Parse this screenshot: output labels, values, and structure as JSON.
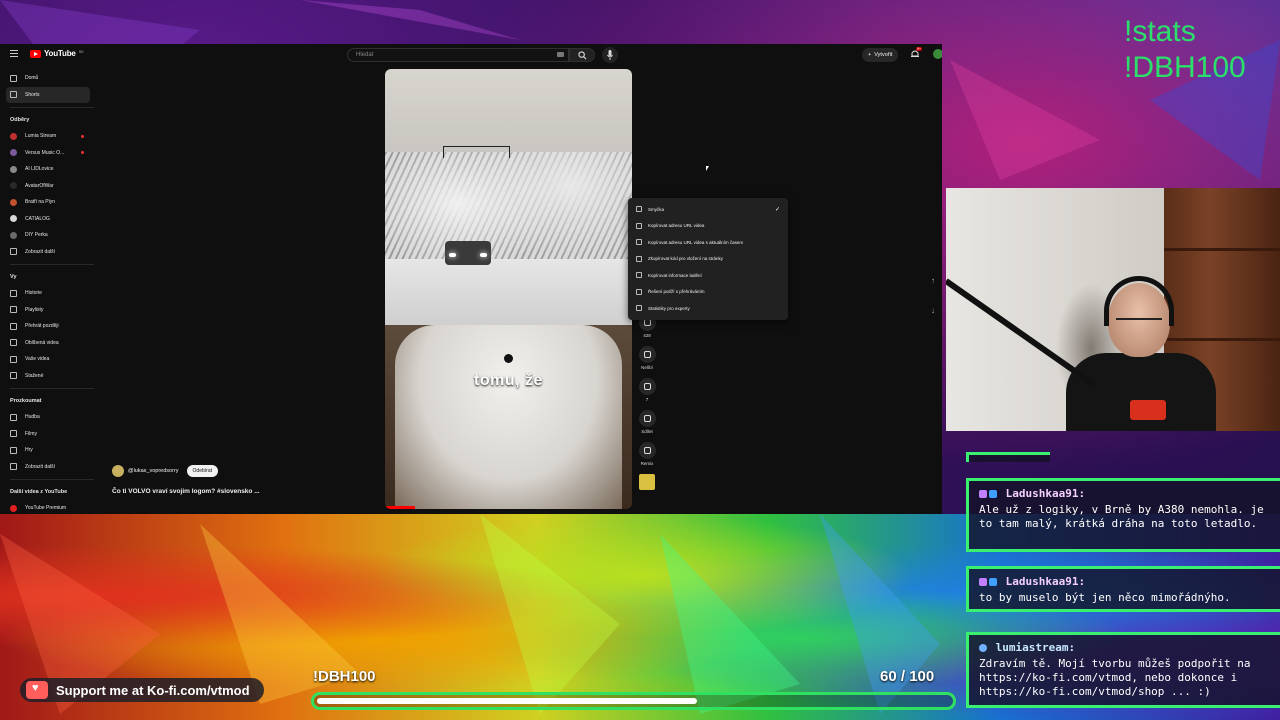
{
  "overlay": {
    "stats_line1": "!stats",
    "stats_line2": "!DBH100",
    "kofi_text": "Support me at Ko-fi.com/vtmod",
    "goal_label": "!DBH100",
    "goal_current": "60",
    "goal_sep": " / ",
    "goal_total": "100",
    "goal_progress": 0.6,
    "accent_color": "#30e060"
  },
  "youtube": {
    "logo_text": "YouTube",
    "country_code": "SK",
    "search_placeholder": "Hledat",
    "create_label": "Vytvořit",
    "notif_count": "9+",
    "sidebar": {
      "main": [
        {
          "label": "Domů",
          "icon": "home-icon"
        },
        {
          "label": "Shorts",
          "icon": "shorts-icon"
        }
      ],
      "subs_title": "Odběry",
      "subs": [
        {
          "label": "Lumia Stream",
          "color": "#c03030",
          "live": true
        },
        {
          "label": "Versus Music O...",
          "color": "#7a5a9a",
          "live": true
        },
        {
          "label": "AI LIDLovice",
          "color": "#8a8a8a",
          "live": false
        },
        {
          "label": "AvatarOfWar",
          "color": "#2a2a2a",
          "live": false
        },
        {
          "label": "Bratři na Plyn",
          "color": "#c05030",
          "live": false
        },
        {
          "label": "CATIALOG",
          "color": "#d8d8d8",
          "live": false
        },
        {
          "label": "DIY Perka",
          "color": "#6a6a6a",
          "live": false
        },
        {
          "label": "Zobrazit další",
          "color": "",
          "live": false
        }
      ],
      "you_title": "Vy",
      "you": [
        {
          "label": "Historie"
        },
        {
          "label": "Playlisty"
        },
        {
          "label": "Přehrát později"
        },
        {
          "label": "Oblíbená videa"
        },
        {
          "label": "Vaše videa"
        },
        {
          "label": "Stažené"
        }
      ],
      "explore_title": "Prozkoumat",
      "explore": [
        {
          "label": "Hudba"
        },
        {
          "label": "Filmy"
        },
        {
          "label": "Hry"
        },
        {
          "label": "Zobrazit další"
        }
      ],
      "more_title": "Další videa z YouTube",
      "more": [
        {
          "label": "YouTube Premium"
        }
      ]
    },
    "video": {
      "caption": "tomu, že",
      "channel": "@lukas_vopredsorry",
      "subscribe_label": "Odebírat",
      "title": "Čo ti VOLVO vraví svojim logom? #slovensko ..."
    },
    "actions": [
      {
        "label": "428",
        "icon": "like-icon"
      },
      {
        "label": "Nelíbí",
        "icon": "dislike-icon"
      },
      {
        "label": "7",
        "icon": "comment-icon"
      },
      {
        "label": "Sdílet",
        "icon": "share-icon"
      },
      {
        "label": "Remix",
        "icon": "remix-icon"
      }
    ],
    "context_menu": [
      {
        "label": "Smyčka",
        "icon": "loop-icon",
        "checked": true
      },
      {
        "label": "Kopírovat adresu URL videa",
        "icon": "link-icon"
      },
      {
        "label": "Kopírovat adresu URL videa s aktuálním časem",
        "icon": "link-icon"
      },
      {
        "label": "Zkopírovat kód pro vložení na stránky",
        "icon": "code-icon"
      },
      {
        "label": "Kopírovat informace ladění",
        "icon": "bug-icon"
      },
      {
        "label": "Řešení potíží s přehráváním",
        "icon": "help-icon"
      },
      {
        "label": "Statistiky pro experty",
        "icon": "info-icon"
      }
    ]
  },
  "chat": [
    {
      "user": "Ladushkaa91:",
      "text": "Ale už z logiky, v Brně by A380 nemohla. je to tam malý, krátká dráha na toto letadlo."
    },
    {
      "user": "Ladushkaa91:",
      "text": "to by muselo být jen něco mimořádnýho."
    },
    {
      "user": "lumiastream:",
      "text": "Zdravím tě. Mojí tvorbu můžeš podpořit na https://ko-fi.com/vtmod, nebo dokonce i https://ko-fi.com/vtmod/shop ... :)"
    }
  ]
}
